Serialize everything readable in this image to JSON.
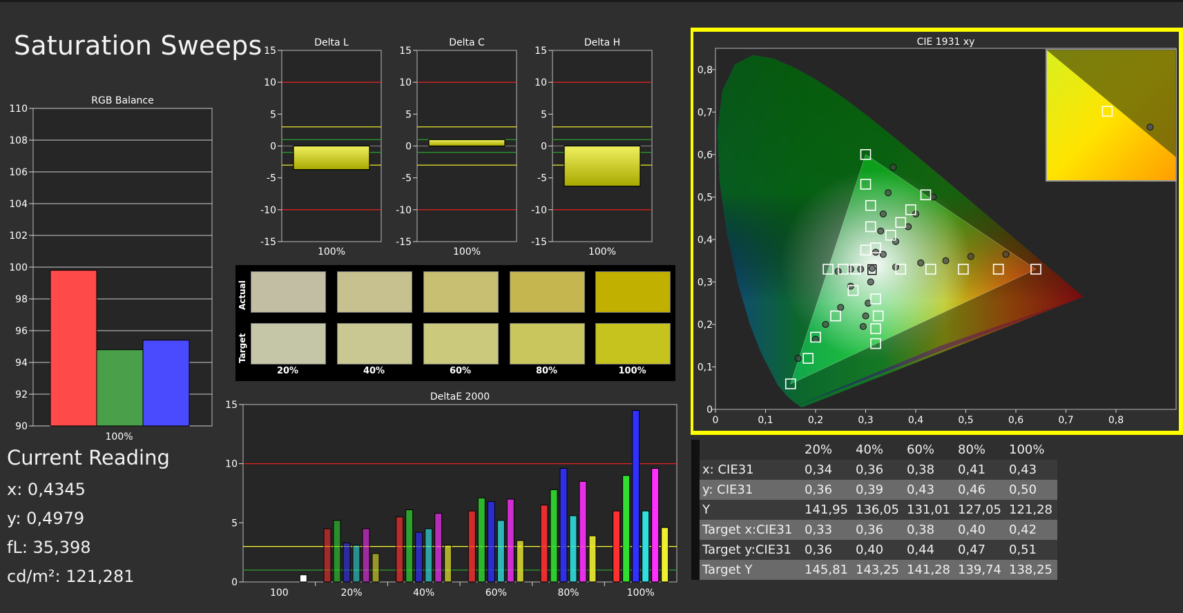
{
  "page": {
    "title": "Saturation Sweeps"
  },
  "colors": {
    "background": "#2f2f2f",
    "panel": "#262626",
    "grid": "#cfcfcf",
    "red_limit": "#ff2020",
    "yellow_limit": "#ffff33",
    "green_limit": "#2ea02e",
    "highlight_border": "#ffff00"
  },
  "current_reading": {
    "heading": "Current Reading",
    "lines": [
      "x: 0,4345",
      "y: 0,4979",
      "fL: 35,398",
      "cd/m²: 121,281"
    ]
  },
  "swatches": {
    "row_labels": [
      "Actual",
      "Target"
    ],
    "steps": [
      "20%",
      "40%",
      "60%",
      "80%",
      "100%"
    ],
    "actual_colors": [
      "#c2bea4",
      "#c7c190",
      "#c8bf72",
      "#c5b650",
      "#c2b000"
    ],
    "target_colors": [
      "#c5c5a8",
      "#c9c893",
      "#cac97c",
      "#c8c65c",
      "#c6c31f"
    ]
  },
  "table": {
    "header": [
      "",
      "20%",
      "40%",
      "60%",
      "80%",
      "100%"
    ],
    "rows": [
      {
        "label": "x: CIE31",
        "values": [
          "0,34",
          "0,36",
          "0,38",
          "0,41",
          "0,43"
        ]
      },
      {
        "label": "y: CIE31",
        "values": [
          "0,36",
          "0,39",
          "0,43",
          "0,46",
          "0,50"
        ]
      },
      {
        "label": "Y",
        "values": [
          "141,95",
          "136,05",
          "131,01",
          "127,05",
          "121,28"
        ]
      },
      {
        "label": "Target x:CIE31",
        "values": [
          "0,33",
          "0,36",
          "0,38",
          "0,40",
          "0,42"
        ]
      },
      {
        "label": "Target y:CIE31",
        "values": [
          "0,36",
          "0,40",
          "0,44",
          "0,47",
          "0,51"
        ]
      },
      {
        "label": "Target Y",
        "values": [
          "145,81",
          "143,25",
          "141,28",
          "139,74",
          "138,25"
        ]
      }
    ]
  },
  "chart_data": [
    {
      "id": "rgb-balance",
      "type": "bar",
      "title": "RGB Balance",
      "categories": [
        "100%"
      ],
      "ylim": [
        90,
        110
      ],
      "yticks": [
        90,
        92,
        94,
        96,
        98,
        100,
        102,
        104,
        106,
        108,
        110
      ],
      "grid": true,
      "series": [
        {
          "color": "#ff4a4a",
          "values": [
            99.8
          ]
        },
        {
          "color": "#4aa04a",
          "values": [
            94.8
          ]
        },
        {
          "color": "#4a4aff",
          "values": [
            95.4
          ]
        }
      ]
    },
    {
      "id": "delta-l",
      "type": "bar",
      "title": "Delta L",
      "categories": [
        "100%"
      ],
      "ylim": [
        -15,
        15
      ],
      "yticks": [
        -15,
        -10,
        -5,
        0,
        5,
        10,
        15
      ],
      "limits": {
        "red": [
          -10,
          10
        ],
        "yellow": [
          -3,
          3
        ],
        "green": [
          -1,
          1
        ]
      },
      "values": [
        -3.7
      ]
    },
    {
      "id": "delta-c",
      "type": "bar",
      "title": "Delta C",
      "categories": [
        "100%"
      ],
      "ylim": [
        -15,
        15
      ],
      "yticks": [
        -15,
        -10,
        -5,
        0,
        5,
        10,
        15
      ],
      "limits": {
        "red": [
          -10,
          10
        ],
        "yellow": [
          -3,
          3
        ],
        "green": [
          -1,
          1
        ]
      },
      "values": [
        1.0
      ]
    },
    {
      "id": "delta-h",
      "type": "bar",
      "title": "Delta H",
      "categories": [
        "100%"
      ],
      "ylim": [
        -15,
        15
      ],
      "yticks": [
        -15,
        -10,
        -5,
        0,
        5,
        10,
        15
      ],
      "limits": {
        "red": [
          -10,
          10
        ],
        "yellow": [
          -3,
          3
        ],
        "green": [
          -1,
          1
        ]
      },
      "values": [
        -6.3
      ]
    },
    {
      "id": "delta-e-2000",
      "type": "bar",
      "title": "DeltaE 2000",
      "categories": [
        "100",
        "20%",
        "40%",
        "60%",
        "80%",
        "100%"
      ],
      "ylim": [
        0,
        15
      ],
      "yticks": [
        0,
        5,
        10,
        15
      ],
      "limits": {
        "red": 10,
        "yellow": 3,
        "green": 1
      },
      "series": [
        {
          "color": "#ff3030",
          "values": [
            0,
            4.5,
            5.5,
            6.0,
            6.5,
            6.0
          ]
        },
        {
          "color": "#30e030",
          "values": [
            0,
            5.2,
            6.1,
            7.1,
            7.8,
            9.0
          ]
        },
        {
          "color": "#3030ff",
          "values": [
            0,
            3.3,
            4.2,
            6.8,
            9.6,
            14.5
          ]
        },
        {
          "color": "#30e0e0",
          "values": [
            0,
            3.1,
            4.5,
            5.2,
            5.6,
            6.0
          ]
        },
        {
          "color": "#ff30ff",
          "values": [
            0,
            4.5,
            5.8,
            7.0,
            8.5,
            9.6
          ]
        },
        {
          "color": "#f0f030",
          "values": [
            0.6,
            2.4,
            3.1,
            3.5,
            3.9,
            4.6
          ]
        }
      ]
    },
    {
      "id": "cie-1931",
      "type": "scatter",
      "title": "CIE 1931 xy",
      "xlim": [
        0,
        0.85
      ],
      "ylim": [
        0,
        0.85
      ],
      "xticks": [
        "0",
        "0,1",
        "0,2",
        "0,3",
        "0,4",
        "0,5",
        "0,6",
        "0,7",
        "0,8"
      ],
      "yticks": [
        "0",
        "0,1",
        "0,2",
        "0,3",
        "0,4",
        "0,5",
        "0,6",
        "0,7",
        "0,8"
      ],
      "gamut_triangle": [
        [
          0.64,
          0.33
        ],
        [
          0.3,
          0.6
        ],
        [
          0.15,
          0.06
        ]
      ],
      "white_point": [
        0.3127,
        0.329
      ],
      "targets": [
        [
          0.3127,
          0.329
        ],
        [
          0.3127,
          0.329
        ],
        [
          0.37,
          0.33
        ],
        [
          0.43,
          0.33
        ],
        [
          0.495,
          0.33
        ],
        [
          0.565,
          0.33
        ],
        [
          0.64,
          0.33
        ],
        [
          0.3,
          0.375
        ],
        [
          0.31,
          0.43
        ],
        [
          0.31,
          0.48
        ],
        [
          0.3,
          0.53
        ],
        [
          0.3,
          0.6
        ],
        [
          0.28,
          0.33
        ],
        [
          0.255,
          0.33
        ],
        [
          0.225,
          0.33
        ],
        [
          0.275,
          0.28
        ],
        [
          0.24,
          0.22
        ],
        [
          0.2,
          0.17
        ],
        [
          0.185,
          0.12
        ],
        [
          0.15,
          0.06
        ],
        [
          0.32,
          0.38
        ],
        [
          0.35,
          0.41
        ],
        [
          0.37,
          0.44
        ],
        [
          0.39,
          0.47
        ],
        [
          0.42,
          0.505
        ],
        [
          0.32,
          0.26
        ],
        [
          0.325,
          0.22
        ],
        [
          0.32,
          0.19
        ],
        [
          0.32,
          0.155
        ]
      ],
      "measured": [
        [
          0.3127,
          0.332
        ],
        [
          0.36,
          0.335
        ],
        [
          0.41,
          0.345
        ],
        [
          0.46,
          0.35
        ],
        [
          0.51,
          0.36
        ],
        [
          0.58,
          0.365
        ],
        [
          0.32,
          0.37
        ],
        [
          0.33,
          0.42
        ],
        [
          0.335,
          0.46
        ],
        [
          0.345,
          0.51
        ],
        [
          0.355,
          0.57
        ],
        [
          0.29,
          0.33
        ],
        [
          0.27,
          0.33
        ],
        [
          0.245,
          0.325
        ],
        [
          0.27,
          0.29
        ],
        [
          0.25,
          0.24
        ],
        [
          0.22,
          0.2
        ],
        [
          0.2,
          0.165
        ],
        [
          0.165,
          0.12
        ],
        [
          0.335,
          0.365
        ],
        [
          0.36,
          0.395
        ],
        [
          0.385,
          0.43
        ],
        [
          0.4,
          0.46
        ],
        [
          0.435,
          0.5
        ],
        [
          0.31,
          0.3
        ],
        [
          0.305,
          0.25
        ],
        [
          0.3,
          0.22
        ],
        [
          0.295,
          0.195
        ]
      ],
      "inset": {
        "target": [
          0.42,
          0.51
        ],
        "measured": [
          0.4345,
          0.4979
        ]
      }
    }
  ]
}
